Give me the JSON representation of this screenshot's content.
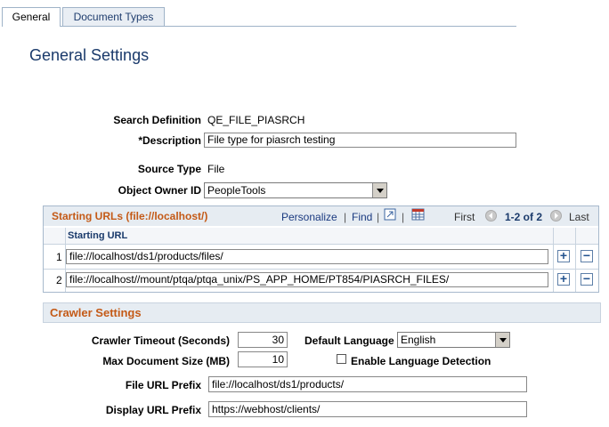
{
  "tabs": [
    {
      "label": "General",
      "active": true
    },
    {
      "label": "Document Types",
      "active": false
    }
  ],
  "page_title": "General Settings",
  "form": {
    "search_definition_label": "Search Definition",
    "search_definition_value": "QE_FILE_PIASRCH",
    "description_label": "*Description",
    "description_value": "File type for piasrch testing",
    "source_type_label": "Source Type",
    "source_type_value": "File",
    "object_owner_label": "Object Owner ID",
    "object_owner_value": "PeopleTools"
  },
  "grid": {
    "title": "Starting URLs (file://localhost/)",
    "personalize": "Personalize",
    "separator": "|",
    "find": "Find",
    "first": "First",
    "range": "1-2 of 2",
    "last": "Last",
    "column_header": "Starting URL",
    "rows": [
      {
        "num": "1",
        "url": "file://localhost/ds1/products/files/"
      },
      {
        "num": "2",
        "url": "file://localhost//mount/ptqa/ptqa_unix/PS_APP_HOME/PT854/PIASRCH_FILES/"
      }
    ]
  },
  "crawler": {
    "section_title": "Crawler Settings",
    "timeout_label": "Crawler Timeout (Seconds)",
    "timeout_value": "30",
    "max_doc_label": "Max Document Size (MB)",
    "max_doc_value": "10",
    "default_language_label": "Default Language",
    "default_language_value": "English",
    "enable_detection_label": "Enable Language Detection",
    "enable_detection_checked": false,
    "file_url_prefix_label": "File URL Prefix",
    "file_url_prefix_value": "file://localhost/ds1/products/",
    "display_url_prefix_label": "Display URL Prefix",
    "display_url_prefix_value": "https://webhost/clients/"
  },
  "colors": {
    "accent_orange": "#c45a17",
    "title_blue": "#1a3a6b",
    "header_bg": "#e6ecf2"
  }
}
